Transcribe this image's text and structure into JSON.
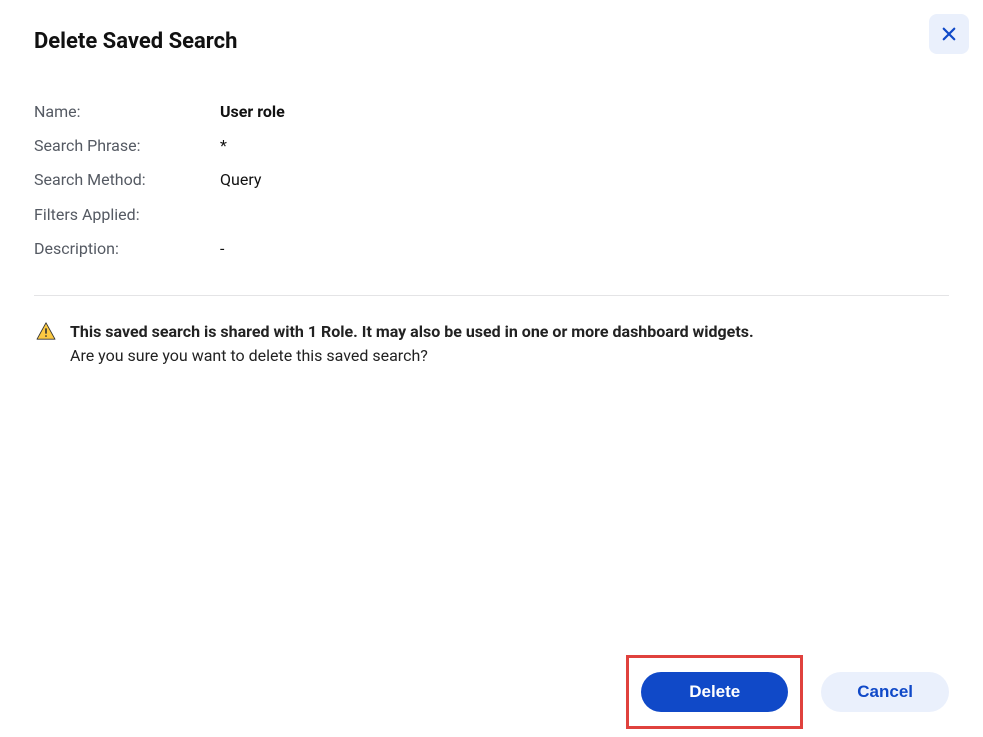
{
  "dialog": {
    "title": "Delete Saved Search"
  },
  "details": {
    "name_label": "Name:",
    "name_value": "User role",
    "phrase_label": "Search Phrase:",
    "phrase_value": "*",
    "method_label": "Search Method:",
    "method_value": "Query",
    "filters_label": "Filters Applied:",
    "filters_value": "",
    "description_label": "Description:",
    "description_value": "-"
  },
  "warning": {
    "bold_text": "This saved search is shared with 1 Role. It may also be used in one or more dashboard widgets.",
    "confirm_text": "Are you sure you want to delete this saved search?"
  },
  "buttons": {
    "delete": "Delete",
    "cancel": "Cancel"
  }
}
